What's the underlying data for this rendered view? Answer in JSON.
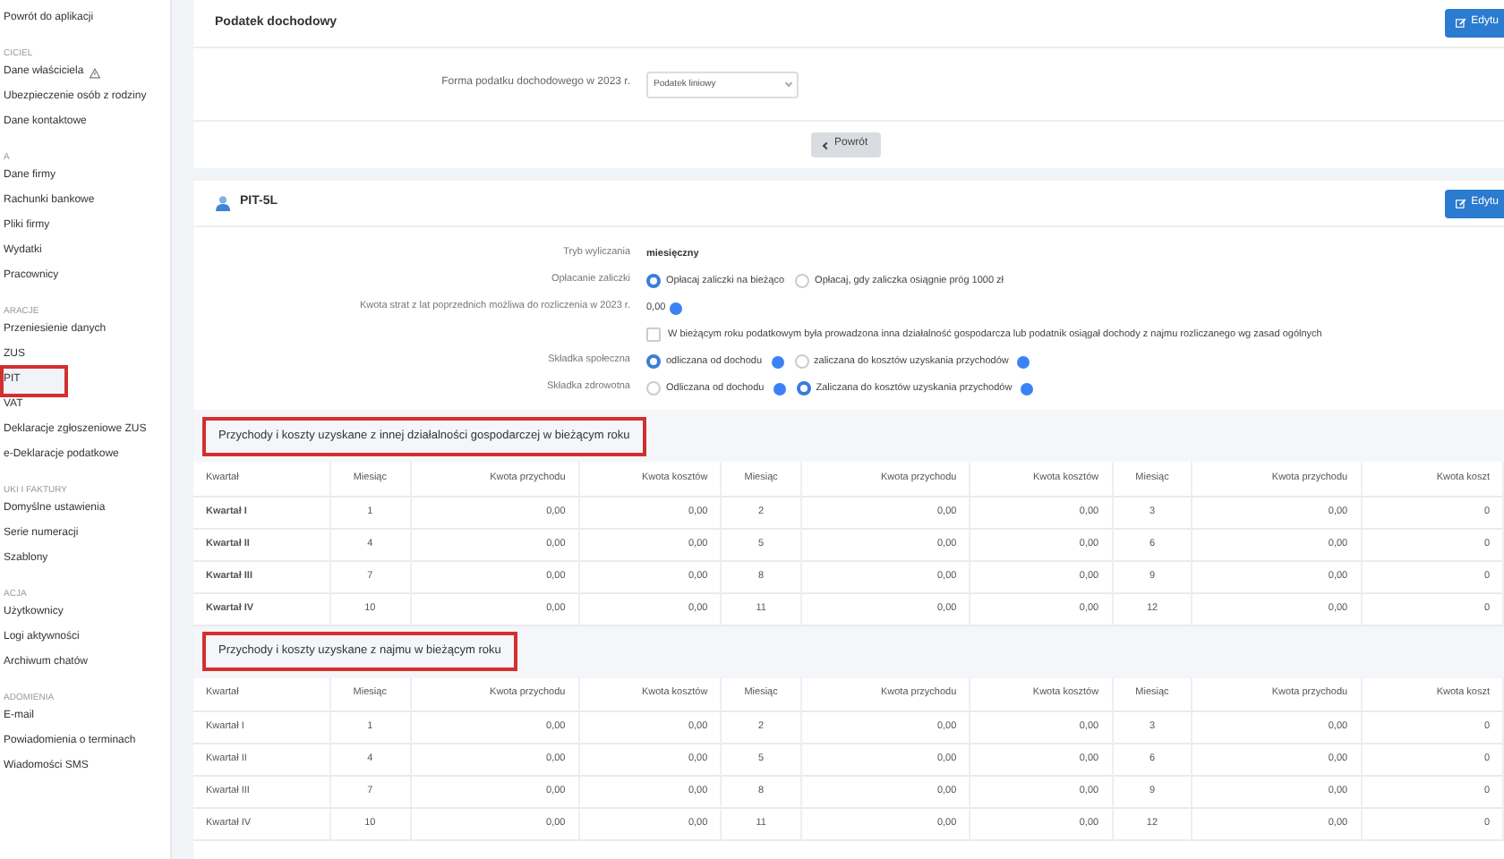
{
  "sidebar": {
    "items": [
      {
        "kind": "link",
        "label": "Powrót do aplikacji",
        "selected": false
      },
      {
        "kind": "section",
        "label": "CICIEL"
      },
      {
        "kind": "link",
        "label": "Dane właściciela",
        "selected": false,
        "warning": true
      },
      {
        "kind": "link",
        "label": "Ubezpieczenie osób z rodziny",
        "selected": false
      },
      {
        "kind": "link",
        "label": "Dane kontaktowe",
        "selected": false
      },
      {
        "kind": "section",
        "label": "A"
      },
      {
        "kind": "link",
        "label": "Dane firmy",
        "selected": false
      },
      {
        "kind": "link",
        "label": "Rachunki bankowe",
        "selected": false
      },
      {
        "kind": "link",
        "label": "Pliki firmy",
        "selected": false
      },
      {
        "kind": "link",
        "label": "Wydatki",
        "selected": false
      },
      {
        "kind": "link",
        "label": "Pracownicy",
        "selected": false
      },
      {
        "kind": "section",
        "label": "ARACJE"
      },
      {
        "kind": "link",
        "label": "Przeniesienie danych",
        "selected": false
      },
      {
        "kind": "link",
        "label": "ZUS",
        "selected": false
      },
      {
        "kind": "link",
        "label": "PIT",
        "selected": true,
        "highlighted": true
      },
      {
        "kind": "link",
        "label": "VAT",
        "selected": false
      },
      {
        "kind": "link",
        "label": "Deklaracje zgłoszeniowe ZUS",
        "selected": false
      },
      {
        "kind": "link",
        "label": "e-Deklaracje podatkowe",
        "selected": false
      },
      {
        "kind": "section",
        "label": "UKI I FAKTURY"
      },
      {
        "kind": "link",
        "label": "Domyślne ustawienia",
        "selected": false
      },
      {
        "kind": "link",
        "label": "Serie numeracji",
        "selected": false
      },
      {
        "kind": "link",
        "label": "Szablony",
        "selected": false
      },
      {
        "kind": "section",
        "label": "ACJA"
      },
      {
        "kind": "link",
        "label": "Użytkownicy",
        "selected": false
      },
      {
        "kind": "link",
        "label": "Logi aktywności",
        "selected": false
      },
      {
        "kind": "link",
        "label": "Archiwum chatów",
        "selected": false
      },
      {
        "kind": "section",
        "label": "ADOMIENIA"
      },
      {
        "kind": "link",
        "label": "E-mail",
        "selected": false
      },
      {
        "kind": "link",
        "label": "Powiadomienia o terminach",
        "selected": false
      },
      {
        "kind": "link",
        "label": "Wiadomości SMS",
        "selected": false
      }
    ]
  },
  "income_tax_panel": {
    "title": "Podatek dochodowy",
    "edit_button": "Edytu",
    "field_label": "Forma podatku dochodowego w 2023 r.",
    "field_value": "Podatek liniowy",
    "back_button": "Powrót"
  },
  "pit_panel": {
    "title": "PIT-5L",
    "edit_button": "Edytu",
    "rows": [
      {
        "kind": "text",
        "label": "Tryb wyliczania",
        "value": "miesięczny"
      },
      {
        "kind": "radio",
        "label": "Opłacanie zaliczki",
        "options": [
          {
            "label": "Opłacaj zaliczki na bieżąco",
            "selected": true,
            "info": false
          },
          {
            "label": "Opłacaj, gdy zaliczka osiągnie próg 1000 zł",
            "selected": false,
            "info": false
          }
        ]
      },
      {
        "kind": "amount",
        "label": "Kwota strat z lat poprzednich możliwa do rozliczenia w 2023 r.",
        "value": "0,00",
        "info": true
      },
      {
        "kind": "checkbox",
        "label": "W bieżącym roku podatkowym była prowadzona inna działalność gospodarcza lub podatnik osiągał dochody z najmu rozliczanego wg zasad ogólnych",
        "checked": false
      },
      {
        "kind": "radio",
        "label": "Składka społeczna",
        "options": [
          {
            "label": "odliczana od dochodu",
            "selected": true,
            "info": true
          },
          {
            "label": "zaliczana do kosztów uzyskania przychodów",
            "selected": false,
            "info": true
          }
        ]
      },
      {
        "kind": "radio",
        "label": "Składka zdrowotna",
        "options": [
          {
            "label": "Odliczana od dochodu",
            "selected": false,
            "info": true
          },
          {
            "label": "Zaliczana do kosztów uzyskania przychodów",
            "selected": true,
            "info": true
          }
        ]
      }
    ]
  },
  "tables": [
    {
      "title": "Przychody i koszty uzyskane z innej działalności gospodarczej w bieżącym roku",
      "highlighted": true,
      "bold_quarters": true,
      "columns": [
        "Kwartał",
        "Miesiąc",
        "Kwota przychodu",
        "Kwota kosztów",
        "Miesiąc",
        "Kwota przychodu",
        "Kwota kosztów",
        "Miesiąc",
        "Kwota przychodu",
        "Kwota koszt"
      ],
      "rows": [
        [
          "Kwartał I",
          "1",
          "0,00",
          "0,00",
          "2",
          "0,00",
          "0,00",
          "3",
          "0,00",
          "0"
        ],
        [
          "Kwartał II",
          "4",
          "0,00",
          "0,00",
          "5",
          "0,00",
          "0,00",
          "6",
          "0,00",
          "0"
        ],
        [
          "Kwartał III",
          "7",
          "0,00",
          "0,00",
          "8",
          "0,00",
          "0,00",
          "9",
          "0,00",
          "0"
        ],
        [
          "Kwartał IV",
          "10",
          "0,00",
          "0,00",
          "11",
          "0,00",
          "0,00",
          "12",
          "0,00",
          "0"
        ]
      ]
    },
    {
      "title": "Przychody i koszty uzyskane z najmu w bieżącym roku",
      "highlighted": true,
      "bold_quarters": false,
      "columns": [
        "Kwartał",
        "Miesiąc",
        "Kwota przychodu",
        "Kwota kosztów",
        "Miesiąc",
        "Kwota przychodu",
        "Kwota kosztów",
        "Miesiąc",
        "Kwota przychodu",
        "Kwota koszt"
      ],
      "rows": [
        [
          "Kwartał I",
          "1",
          "0,00",
          "0,00",
          "2",
          "0,00",
          "0,00",
          "3",
          "0,00",
          "0"
        ],
        [
          "Kwartał II",
          "4",
          "0,00",
          "0,00",
          "5",
          "0,00",
          "0,00",
          "6",
          "0,00",
          "0"
        ],
        [
          "Kwartał III",
          "7",
          "0,00",
          "0,00",
          "8",
          "0,00",
          "0,00",
          "9",
          "0,00",
          "0"
        ],
        [
          "Kwartał IV",
          "10",
          "0,00",
          "0,00",
          "11",
          "0,00",
          "0,00",
          "12",
          "0,00",
          "0"
        ]
      ]
    }
  ]
}
